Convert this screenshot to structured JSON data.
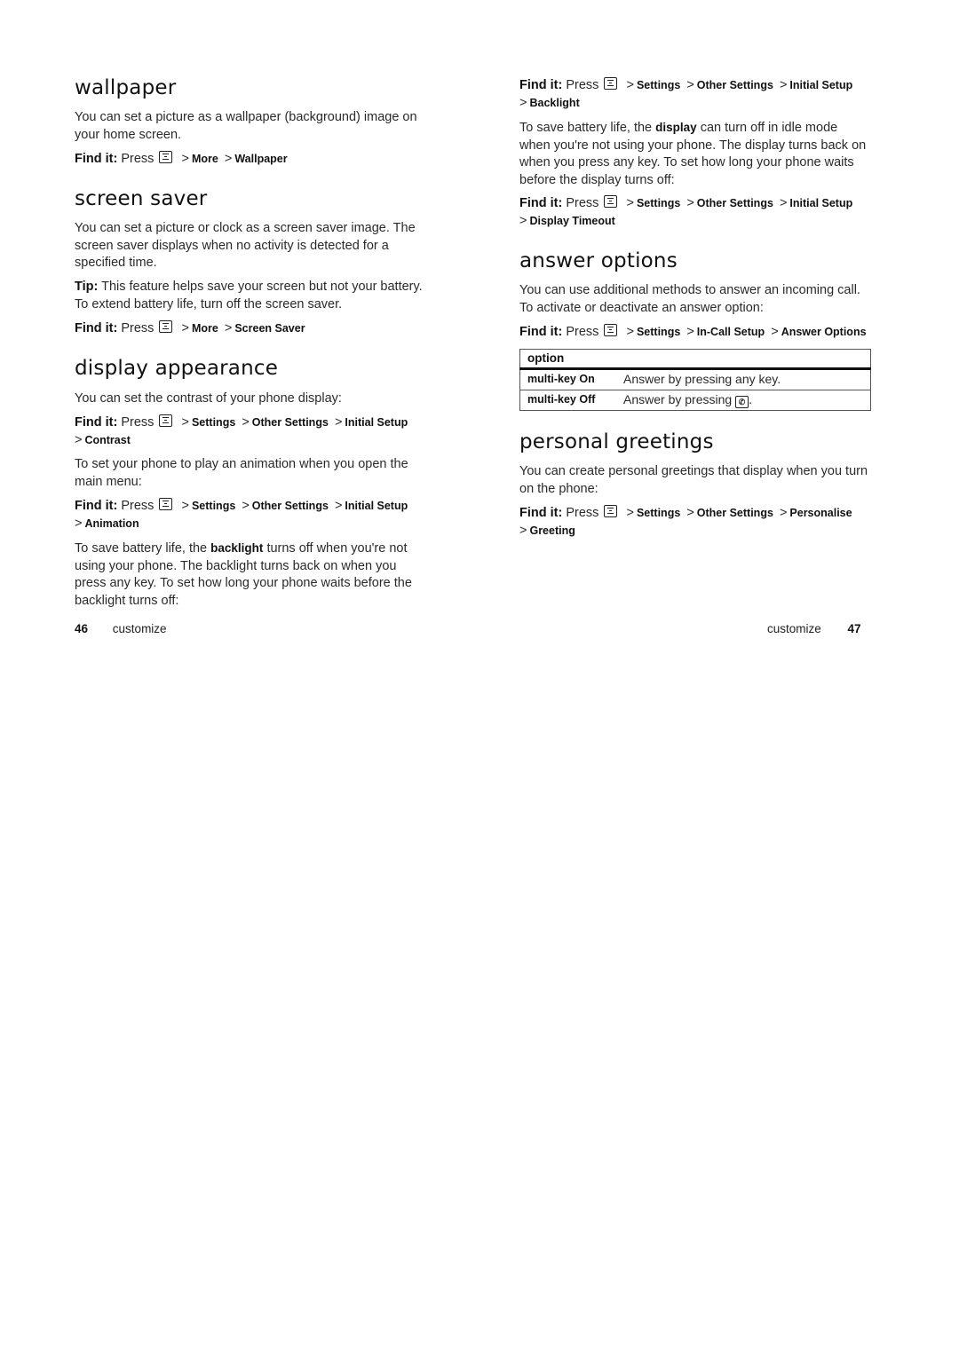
{
  "left_page": {
    "page_number": "46",
    "section_label": "customize",
    "wallpaper": {
      "title": "wallpaper",
      "body": "You can set a picture as a wallpaper (background) image on your home screen.",
      "findit": {
        "label": "Find it:",
        "press": "Press",
        "path": [
          "More",
          "Wallpaper"
        ]
      }
    },
    "screen_saver": {
      "title": "screen saver",
      "body": "You can set a picture or clock as a screen saver image. The screen saver displays when no activity is detected for a specified time.",
      "tip_label": "Tip:",
      "tip_text": "This feature helps save your screen but not your battery. To extend battery life, turn off the screen saver.",
      "findit": {
        "label": "Find it:",
        "press": "Press",
        "path": [
          "More",
          "Screen Saver"
        ]
      }
    },
    "display_appearance": {
      "title": "display appearance",
      "body1": "You can set the contrast of your phone display:",
      "findit1": {
        "label": "Find it:",
        "press": "Press",
        "path": [
          "Settings",
          "Other Settings",
          "Initial Setup",
          "Contrast"
        ]
      },
      "body2": "To set your phone to play an animation when you open the main menu:",
      "findit2": {
        "label": "Find it:",
        "press": "Press",
        "path": [
          "Settings",
          "Other Settings",
          "Initial Setup",
          "Animation"
        ]
      },
      "body3_pre": "To save battery life, the",
      "body3_kw": "backlight",
      "body3_post": "turns off when you're not using your phone. The backlight turns back on when you press any key. To set how long your phone waits before the backlight turns off:"
    }
  },
  "right_page": {
    "page_number": "47",
    "section_label": "customize",
    "backlight_findit": {
      "label": "Find it:",
      "press": "Press",
      "path": [
        "Settings",
        "Other Settings",
        "Initial Setup",
        "Backlight"
      ]
    },
    "display_body_pre": "To save battery life, the",
    "display_body_kw": "display",
    "display_body_post": "can turn off in idle mode when you're not using your phone. The display turns back on when you press any key. To set how long your phone waits before the display turns off:",
    "display_findit": {
      "label": "Find it:",
      "press": "Press",
      "path": [
        "Settings",
        "Other Settings",
        "Initial Setup",
        "Display Timeout"
      ]
    },
    "answer_options": {
      "title": "answer options",
      "body": "You can use additional methods to answer an incoming call. To activate or deactivate an answer option:",
      "findit": {
        "label": "Find it:",
        "press": "Press",
        "path": [
          "Settings",
          "In-Call Setup",
          "Answer Options"
        ]
      },
      "table": {
        "header": "option",
        "rows": [
          {
            "option": "multi-key On",
            "description": "Answer by pressing any key."
          },
          {
            "option": "multi-key Off",
            "description": "Answer by pressing",
            "icon": "send-key-icon"
          }
        ]
      }
    },
    "personal_greetings": {
      "title": "personal greetings",
      "body": "You can create personal greetings that display when you turn on the phone:",
      "findit": {
        "label": "Find it:",
        "press": "Press",
        "path": [
          "Settings",
          "Other Settings",
          "Personalise",
          "Greeting"
        ]
      }
    }
  },
  "icons": {
    "menu_key": "menu-key-icon",
    "send_key": "send-key-icon",
    "separator": ">"
  }
}
